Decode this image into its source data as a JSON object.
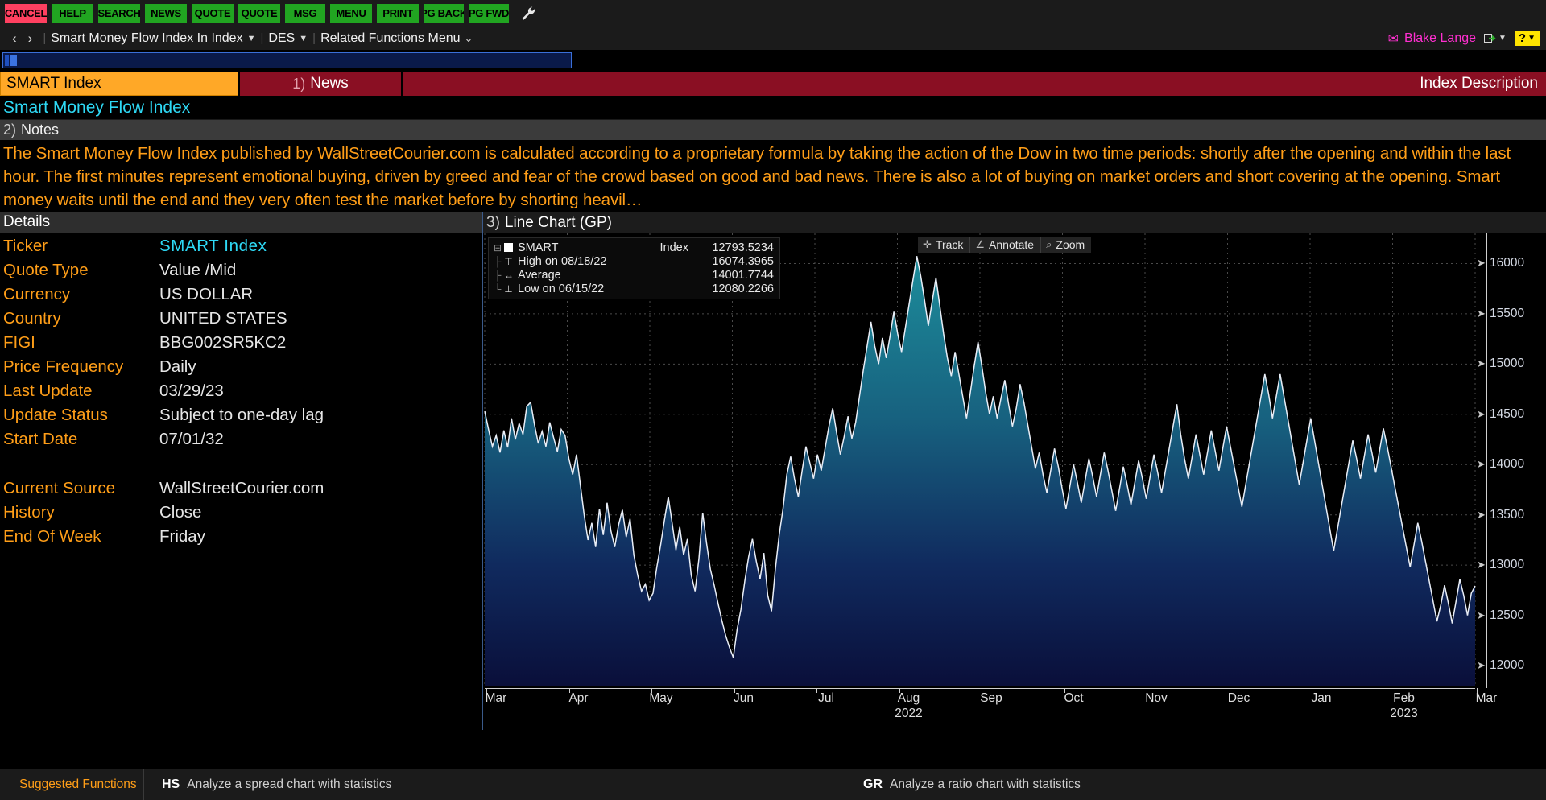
{
  "toolbar": {
    "buttons": [
      {
        "label": "CANCEL",
        "kind": "cancel"
      },
      {
        "label": "HELP",
        "kind": "normal"
      },
      {
        "label": "SEARCH",
        "kind": "normal"
      },
      {
        "label": "NEWS",
        "kind": "normal"
      },
      {
        "label": "QUOTE",
        "kind": "normal"
      },
      {
        "label": "QUOTE",
        "kind": "normal"
      },
      {
        "label": "MSG",
        "kind": "normal"
      },
      {
        "label": "MENU",
        "kind": "normal"
      },
      {
        "label": "PRINT",
        "kind": "normal"
      },
      {
        "label": "PG BACK",
        "kind": "normal"
      },
      {
        "label": "PG FWD",
        "kind": "normal"
      }
    ],
    "settings_icon": "wrench-icon"
  },
  "navbar": {
    "back_arrow": "‹",
    "forward_arrow": "›",
    "security": "Smart Money Flow Index In Index",
    "function": "DES",
    "related": "Related Functions Menu",
    "user_name": "Blake Lange",
    "mail_icon": "envelope-icon",
    "export_icon": "export-icon",
    "help_label": "?"
  },
  "command_line": {
    "value": ""
  },
  "tabs": {
    "active": "SMART Index",
    "news": {
      "number": "1)",
      "label": "News"
    },
    "right_label": "Index Description"
  },
  "page": {
    "subtitle": "Smart Money Flow Index"
  },
  "notes": {
    "number": "2)",
    "title": "Notes",
    "body": "The Smart Money Flow Index published by WallStreetCourier.com is calculated according to a proprietary formula by taking the action of the Dow in two time periods: shortly after the opening and within the last hour. The first minutes represent emotional buying, driven by greed and fear of the crowd based on good and bad news. There is also a lot of buying on market orders and short covering at the opening. Smart money waits until the end and they very often test the market before by shorting heavil…"
  },
  "details": {
    "title": "Details",
    "rows": [
      {
        "label": "Ticker",
        "value": "SMART  Index",
        "style": "cyan"
      },
      {
        "label": "Quote Type",
        "value": "Value /Mid",
        "style": "plain"
      },
      {
        "label": "Currency",
        "value": "US DOLLAR",
        "style": "plain"
      },
      {
        "label": "Country",
        "value": "UNITED STATES",
        "style": "plain"
      },
      {
        "label": "FIGI",
        "value": "BBG002SR5KC2",
        "style": "plain"
      },
      {
        "label": "Price Frequency",
        "value": "Daily",
        "style": "plain"
      },
      {
        "label": "Last Update",
        "value": "03/29/23",
        "style": "plain"
      },
      {
        "label": "Update Status",
        "value": "Subject to one-day lag",
        "style": "plain"
      },
      {
        "label": "Start Date",
        "value": "07/01/32",
        "style": "plain"
      }
    ],
    "rows2": [
      {
        "label": "Current Source",
        "value": "WallStreetCourier.com",
        "style": "plain"
      },
      {
        "label": "History",
        "value": "Close",
        "style": "plain"
      },
      {
        "label": "End Of Week",
        "value": "Friday",
        "style": "plain"
      }
    ]
  },
  "chart_panel": {
    "number": "3)",
    "title": "Line Chart (GP)",
    "tools": [
      {
        "label": "Track",
        "icon": "crosshair-icon"
      },
      {
        "label": "Annotate",
        "icon": "angle-icon"
      },
      {
        "label": "Zoom",
        "icon": "magnifier-icon"
      }
    ],
    "legend": [
      {
        "tree": "⊟",
        "swatch": true,
        "name": "SMART",
        "unit": "Index",
        "value": "12793.5234"
      },
      {
        "tree": "├",
        "marker": "⊤",
        "name": "High on 08/18/22",
        "unit": "",
        "value": "16074.3965"
      },
      {
        "tree": "├",
        "marker": "↔",
        "name": "Average",
        "unit": "",
        "value": "14001.7744"
      },
      {
        "tree": "└",
        "marker": "⊥",
        "name": "Low on 06/15/22",
        "unit": "",
        "value": "12080.2266"
      }
    ]
  },
  "chart_data": {
    "type": "area",
    "title": "Line Chart (GP)",
    "series_name": "SMART",
    "xlabel": "",
    "ylabel": "Index",
    "ylim": [
      11800,
      16300
    ],
    "yticks": [
      12000,
      12500,
      13000,
      13500,
      14000,
      14500,
      15000,
      15500,
      16000
    ],
    "grid": true,
    "legend_position": "top-left",
    "last_value": 12793.5234,
    "high": {
      "value": 16074.3965,
      "date": "08/18/22"
    },
    "low": {
      "value": 12080.2266,
      "date": "06/15/22"
    },
    "average": 14001.7744,
    "xticks": [
      {
        "label": "Mar",
        "year": ""
      },
      {
        "label": "Apr",
        "year": ""
      },
      {
        "label": "May",
        "year": ""
      },
      {
        "label": "Jun",
        "year": ""
      },
      {
        "label": "Jul",
        "year": ""
      },
      {
        "label": "Aug",
        "year": "2022"
      },
      {
        "label": "Sep",
        "year": ""
      },
      {
        "label": "Oct",
        "year": ""
      },
      {
        "label": "Nov",
        "year": ""
      },
      {
        "label": "Dec",
        "year": ""
      },
      {
        "label": "Jan",
        "year": ""
      },
      {
        "label": "Feb",
        "year": "2023"
      },
      {
        "label": "Mar",
        "year": ""
      }
    ],
    "values": [
      14530,
      14350,
      14180,
      14290,
      14120,
      14340,
      14170,
      14460,
      14250,
      14410,
      14300,
      14580,
      14620,
      14400,
      14210,
      14330,
      14180,
      14420,
      14270,
      14130,
      14350,
      14290,
      14060,
      13900,
      14100,
      13800,
      13500,
      13250,
      13420,
      13180,
      13560,
      13300,
      13620,
      13340,
      13180,
      13400,
      13550,
      13280,
      13460,
      13100,
      12900,
      12740,
      12810,
      12650,
      12720,
      12980,
      13200,
      13450,
      13680,
      13420,
      13150,
      13380,
      13100,
      13260,
      12900,
      12740,
      13060,
      13520,
      13220,
      12960,
      12800,
      12620,
      12450,
      12300,
      12180,
      12080,
      12360,
      12560,
      12840,
      13080,
      13260,
      13040,
      12860,
      13120,
      12700,
      12540,
      12960,
      13300,
      13560,
      13900,
      14080,
      13860,
      13680,
      13940,
      14180,
      14020,
      13860,
      14100,
      13940,
      14160,
      14380,
      14560,
      14320,
      14100,
      14280,
      14480,
      14260,
      14420,
      14680,
      14940,
      15180,
      15420,
      15180,
      15000,
      15260,
      15060,
      15280,
      15520,
      15300,
      15120,
      15360,
      15600,
      15840,
      16074,
      15880,
      15640,
      15380,
      15620,
      15860,
      15580,
      15300,
      15060,
      14880,
      15120,
      14900,
      14680,
      14460,
      14720,
      14980,
      15220,
      14980,
      14720,
      14500,
      14680,
      14460,
      14660,
      14840,
      14600,
      14380,
      14560,
      14800,
      14620,
      14400,
      14180,
      13960,
      14120,
      13900,
      13720,
      13940,
      14160,
      13980,
      13760,
      13560,
      13780,
      14000,
      13820,
      13620,
      13840,
      14060,
      13880,
      13680,
      13900,
      14120,
      13940,
      13740,
      13540,
      13760,
      13980,
      13800,
      13600,
      13820,
      14040,
      13860,
      13660,
      13880,
      14100,
      13920,
      13720,
      13940,
      14160,
      14380,
      14600,
      14300,
      14060,
      13860,
      14080,
      14300,
      14100,
      13900,
      14120,
      14340,
      14140,
      13940,
      14160,
      14380,
      14180,
      13980,
      13780,
      13580,
      13800,
      14020,
      14240,
      14460,
      14680,
      14900,
      14700,
      14460,
      14680,
      14900,
      14680,
      14460,
      14240,
      14020,
      13800,
      14020,
      14240,
      14460,
      14240,
      14020,
      13800,
      13580,
      13360,
      13140,
      13360,
      13580,
      13800,
      14020,
      14240,
      14060,
      13860,
      14080,
      14300,
      14120,
      13920,
      14140,
      14360,
      14180,
      13980,
      13780,
      13580,
      13380,
      13180,
      12980,
      13200,
      13420,
      13240,
      13040,
      12840,
      12640,
      12440,
      12600,
      12800,
      12620,
      12420,
      12640,
      12860,
      12700,
      12500,
      12720,
      12793
    ]
  },
  "bottom_bar": {
    "label": "Suggested Functions",
    "items": [
      {
        "code": "HS",
        "desc": "Analyze a spread chart with statistics"
      },
      {
        "code": "GR",
        "desc": "Analyze a ratio chart with statistics"
      }
    ]
  }
}
